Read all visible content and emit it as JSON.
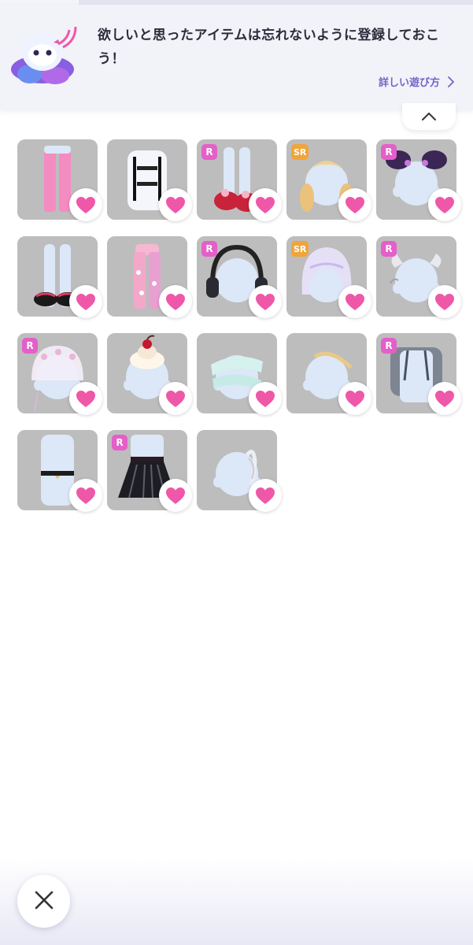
{
  "banner": {
    "message": "欲しいと思ったアイテムは忘れないように登録しておこう！",
    "howto_label": "詳しい遊び方"
  },
  "colors": {
    "accent": "#6f66c8",
    "heart": "#ef57a8",
    "rarity_r": "#e45fc9",
    "rarity_sr": "#f0a43a",
    "card_bg": "#bdbdbd"
  },
  "items": [
    {
      "rarity": "",
      "kind": "pink-pants"
    },
    {
      "rarity": "",
      "kind": "white-suspender-shirt"
    },
    {
      "rarity": "R",
      "kind": "red-shoes"
    },
    {
      "rarity": "SR",
      "kind": "blonde-twin-hair"
    },
    {
      "rarity": "R",
      "kind": "purple-hair-accessory"
    },
    {
      "rarity": "",
      "kind": "black-shoes"
    },
    {
      "rarity": "",
      "kind": "pink-floral-pants"
    },
    {
      "rarity": "R",
      "kind": "headphones"
    },
    {
      "rarity": "SR",
      "kind": "lavender-bob-hair"
    },
    {
      "rarity": "R",
      "kind": "silver-horns"
    },
    {
      "rarity": "R",
      "kind": "floral-bonnet"
    },
    {
      "rarity": "",
      "kind": "cherry-hat"
    },
    {
      "rarity": "",
      "kind": "mint-bandage"
    },
    {
      "rarity": "",
      "kind": "gold-headband"
    },
    {
      "rarity": "R",
      "kind": "gray-jacket"
    },
    {
      "rarity": "",
      "kind": "heart-choker"
    },
    {
      "rarity": "R",
      "kind": "black-pleated-skirt"
    },
    {
      "rarity": "",
      "kind": "white-bow"
    }
  ],
  "icons": {
    "favorite": "heart-icon",
    "collapse": "chevron-up-icon",
    "close": "close-icon",
    "more": "chevron-right-icon"
  }
}
